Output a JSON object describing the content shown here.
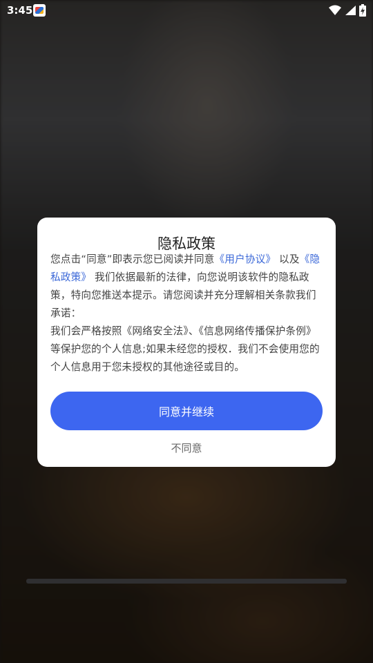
{
  "status_bar": {
    "time": "3:45",
    "icons": [
      "app-notification-icon",
      "wifi-icon",
      "cellular-signal-icon",
      "battery-charging-icon"
    ]
  },
  "dialog": {
    "title": "隐私政策",
    "body": {
      "intro_prefix": "您点击“同意”即表示您已阅读并同意",
      "user_agreement_link": "《用户协议》",
      "and_text": "以及",
      "privacy_policy_link": "《隐私政策》",
      "intro_suffix": "我们依据最新的法律，向您说明该软件的隐私政策，特向您推送本提示。请您阅读并充分理解相关条款我们承诺：",
      "commitment": "我们会严格按照《网络安全法》、《信息网络传播保护条例》等保护您的个人信息;如果未经您的授权．我们不会使用您的个人信息用于您未授权的其他途径或目的。"
    },
    "agree_button": "同意并继续",
    "disagree_button": "不同意"
  },
  "colors": {
    "accent": "#3d66f0",
    "link": "#3b68d8",
    "dialog_bg": "#ffffff"
  }
}
